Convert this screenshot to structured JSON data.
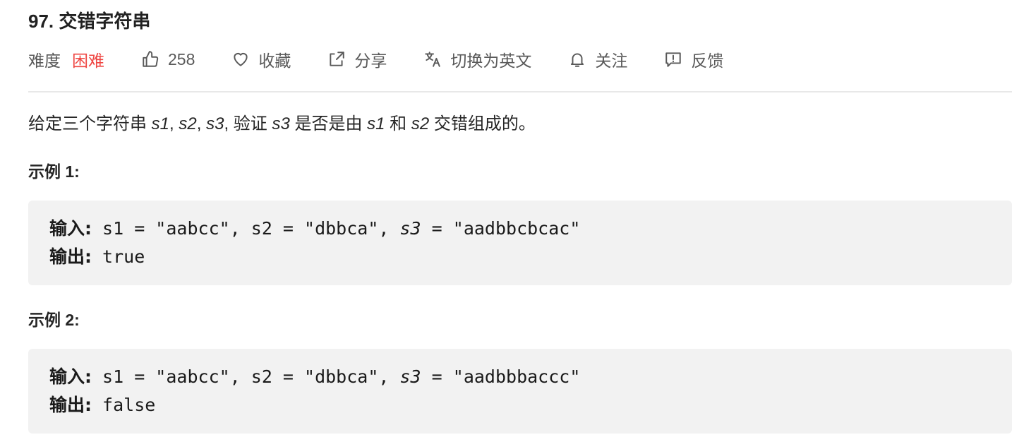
{
  "problem": {
    "title": "97. 交错字符串"
  },
  "meta": {
    "difficulty_label": "难度",
    "difficulty_value": "困难",
    "likes": "258",
    "favorite_label": "收藏",
    "share_label": "分享",
    "lang_label": "切换为英文",
    "follow_label": "关注",
    "feedback_label": "反馈",
    "icons": {
      "likes": "thumbs-up-icon",
      "favorite": "heart-icon",
      "share": "share-icon",
      "lang": "translate-icon",
      "follow": "bell-icon",
      "feedback": "feedback-icon"
    },
    "difficulty_color": "#ef4743"
  },
  "description": {
    "prefix": "给定三个字符串 ",
    "s1": "s1",
    "sep1": ", ",
    "s2": "s2",
    "sep2": ", ",
    "s3": "s3",
    "mid1": ", 验证 ",
    "s3b": "s3",
    "mid2": " 是否是由 ",
    "s1b": "s1",
    "mid3": " 和 ",
    "s2b": "s2",
    "suffix": " 交错组成的。"
  },
  "examples": [
    {
      "title": "示例 1:",
      "input_label": "输入:",
      "input_part1": " s1 = \"aabcc\", s2 = \"dbbca\", ",
      "input_s3": "s3",
      "input_part2": " = \"aadbbcbcac\"",
      "output_label": "输出:",
      "output_value": " true"
    },
    {
      "title": "示例 2:",
      "input_label": "输入:",
      "input_part1": " s1 = \"aabcc\", s2 = \"dbbca\", ",
      "input_s3": "s3",
      "input_part2": " = \"aadbbbaccc\"",
      "output_label": "输出:",
      "output_value": " false"
    }
  ]
}
